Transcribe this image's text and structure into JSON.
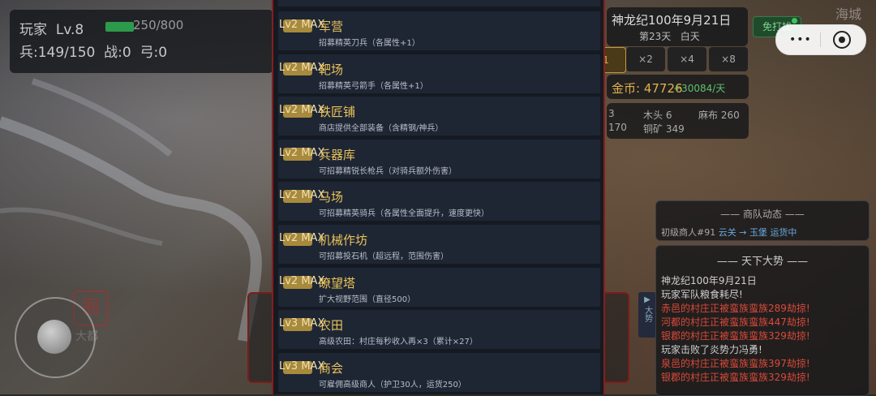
{
  "player": {
    "name": "玩家",
    "level": "Lv.8",
    "exp": "250/800",
    "exp_fraction": 0.3125,
    "soldiers": "兵:149/150",
    "battle": "战:0",
    "bow": "弓:0"
  },
  "date": {
    "full": "神龙纪100年9月21日",
    "day": "第23天",
    "period": "白天"
  },
  "peace_button": "免打扰",
  "corner_label": "海城",
  "mini_program": {
    "more": "•••",
    "close": "close"
  },
  "speeds": [
    "1",
    "×2",
    "×4",
    "×8"
  ],
  "gold": {
    "label": "金币: 47726",
    "rate": "+30084/天"
  },
  "resources": {
    "top_left": "3",
    "wood": "木头 6",
    "cloth": "麻布 260",
    "bottom_left": "170",
    "copper": "铜矿 349"
  },
  "side_tab": "大势",
  "caravan": {
    "title": "—— 商队动态 ——",
    "merchant": "初级商人#91",
    "from": "云关",
    "arrow": "→",
    "to": "玉堡",
    "status": "运货中"
  },
  "world": {
    "title": "—— 天下大势 ——",
    "events": [
      {
        "text": "神龙纪100年9月21日",
        "color": "#cfcfcf"
      },
      {
        "text": "玩家军队粮食耗尽!",
        "color": "#cfcfcf"
      },
      {
        "text": "赤邑的村庄正被蛮族蛮族289劫掠!",
        "color": "#d94a3a"
      },
      {
        "text": "河都的村庄正被蛮族蛮族447劫掠!",
        "color": "#d94a3a"
      },
      {
        "text": "银郡的村庄正被蛮族蛮族329劫掠!",
        "color": "#d94a3a"
      },
      {
        "text": "玩家击败了炎势力冯勇!",
        "color": "#cfcfcf"
      },
      {
        "text": "泉邑的村庄正被蛮族蛮族397劫掠!",
        "color": "#d94a3a"
      },
      {
        "text": "银郡的村庄正被蛮族蛮族329劫掠!",
        "color": "#d94a3a"
      }
    ]
  },
  "seal": {
    "glyph": "囿",
    "label": "大都"
  },
  "buildings": [
    {
      "level": "Lv2 MAX",
      "name": "军营",
      "desc": "招募精英刀兵（各属性+1）"
    },
    {
      "level": "Lv2 MAX",
      "name": "靶场",
      "desc": "招募精英弓箭手（各属性+1）"
    },
    {
      "level": "Lv2 MAX",
      "name": "铁匠铺",
      "desc": "商店提供全部装备（含精钢/神兵）"
    },
    {
      "level": "Lv2 MAX",
      "name": "兵器库",
      "desc": "可招募精锐长枪兵（对骑兵额外伤害）"
    },
    {
      "level": "Lv2 MAX",
      "name": "马场",
      "desc": "可招募精英骑兵（各属性全面提升，速度更快）"
    },
    {
      "level": "Lv2 MAX",
      "name": "机械作坊",
      "desc": "可招募投石机（超远程，范围伤害）"
    },
    {
      "level": "Lv2 MAX",
      "name": "瞭望塔",
      "desc": "扩大视野范围（直径500）"
    },
    {
      "level": "Lv3 MAX",
      "name": "农田",
      "desc": "高级农田：村庄每秒收入再×3（累计×27）"
    },
    {
      "level": "Lv3 MAX",
      "name": "商会",
      "desc": "可雇佣高级商人（护卫30人，运货250）"
    }
  ]
}
